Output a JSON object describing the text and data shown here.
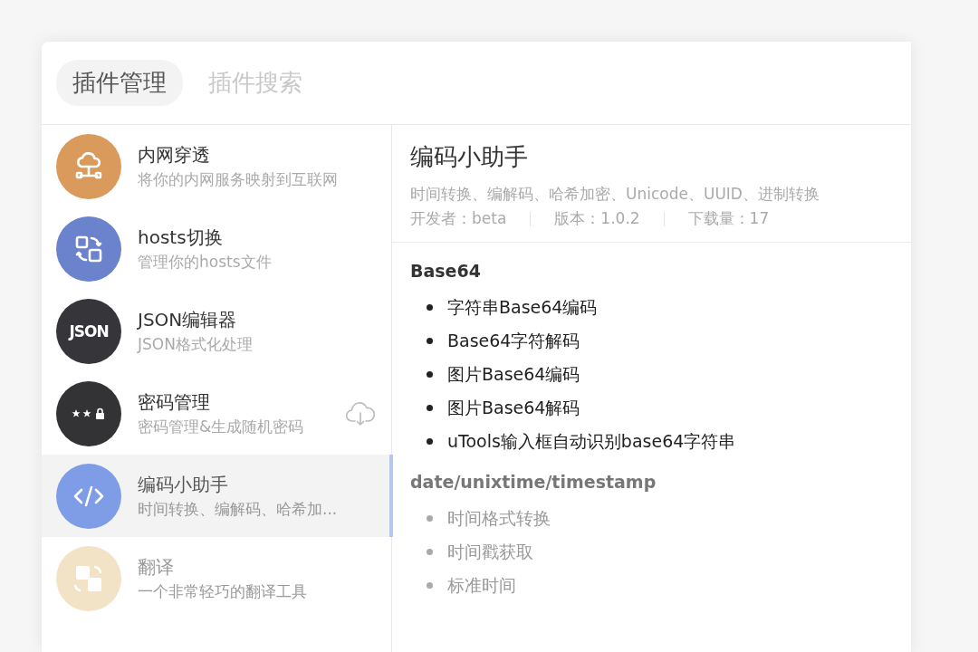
{
  "tabs": [
    {
      "label": "插件管理",
      "selected": true
    },
    {
      "label": "插件搜索",
      "selected": false
    }
  ],
  "plugins": [
    {
      "kind": "cloud",
      "color": "#d99a5b",
      "name": "内网穿透",
      "description": "将你的内网服务映射到互联网",
      "selected": false,
      "downloadable": false
    },
    {
      "kind": "swap",
      "color": "#6b82cc",
      "name": "hosts切换",
      "description": "管理你的hosts文件",
      "selected": false,
      "downloadable": false
    },
    {
      "kind": "json",
      "color": "#36363a",
      "icon_label": "JSON",
      "name": "JSON编辑器",
      "description": "JSON格式化处理",
      "selected": false,
      "downloadable": false
    },
    {
      "kind": "password",
      "color": "#333336",
      "name": "密码管理",
      "description": "密码管理&生成随机密码",
      "selected": false,
      "downloadable": true
    },
    {
      "kind": "code",
      "color": "#7f9ce6",
      "name": "编码小助手",
      "description": "时间转换、编解码、哈希加...",
      "selected": true,
      "downloadable": false
    },
    {
      "kind": "translate",
      "color": "#f3e3c6",
      "name": "翻译",
      "description": "一个非常轻巧的翻译工具",
      "selected": false,
      "downloadable": false
    }
  ],
  "detail": {
    "title": "编码小助手",
    "description": "时间转换、编解码、哈希加密、Unicode、UUID、进制转换",
    "meta": [
      "开发者：beta",
      "版本：1.0.2",
      "下载量：17"
    ],
    "sections": [
      {
        "heading": "Base64",
        "items": [
          "字符串Base64编码",
          "Base64字符解码",
          "图片Base64编码",
          "图片Base64解码",
          "uTools输入框自动识别base64字符串"
        ]
      },
      {
        "heading": "date/unixtime/timestamp",
        "items": [
          "时间格式转换",
          "时间戳获取",
          "标准时间"
        ]
      }
    ]
  }
}
